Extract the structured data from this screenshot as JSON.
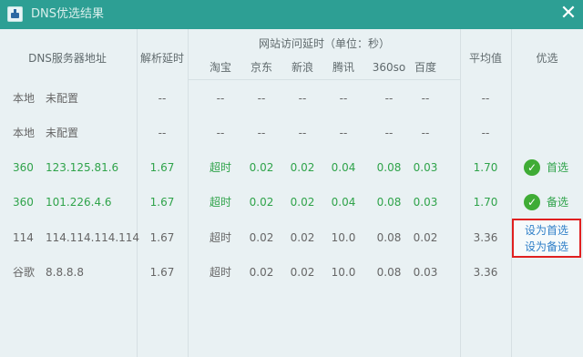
{
  "window": {
    "title": "DNS优选结果",
    "close_glyph": "✕"
  },
  "headers": {
    "server": "DNS服务器地址",
    "resolve_delay": "解析延时",
    "site_group": "网站访问延时（单位：秒）",
    "sites": [
      "淘宝",
      "京东",
      "新浪",
      "腾讯",
      "360so",
      "百度"
    ],
    "average": "平均值",
    "preferred": "优选"
  },
  "rows": [
    {
      "isp": "本地",
      "address": "未配置",
      "resolve": "--",
      "sites": [
        "--",
        "--",
        "--",
        "--",
        "--",
        "--"
      ],
      "average": "--",
      "status": ""
    },
    {
      "isp": "本地",
      "address": "未配置",
      "resolve": "--",
      "sites": [
        "--",
        "--",
        "--",
        "--",
        "--",
        "--"
      ],
      "average": "--",
      "status": ""
    },
    {
      "isp": "360",
      "address": "123.125.81.6",
      "resolve": "1.67",
      "sites": [
        "超时",
        "0.02",
        "0.02",
        "0.04",
        "0.08",
        "0.03"
      ],
      "average": "1.70",
      "status": "首选"
    },
    {
      "isp": "360",
      "address": "101.226.4.6",
      "resolve": "1.67",
      "sites": [
        "超时",
        "0.02",
        "0.02",
        "0.04",
        "0.08",
        "0.03"
      ],
      "average": "1.70",
      "status": "备选"
    },
    {
      "isp": "114",
      "address": "114.114.114.114",
      "resolve": "1.67",
      "sites": [
        "超时",
        "0.02",
        "0.02",
        "10.0",
        "0.08",
        "0.02"
      ],
      "average": "3.36",
      "status": ""
    },
    {
      "isp": "谷歌",
      "address": "8.8.8.8",
      "resolve": "1.67",
      "sites": [
        "超时",
        "0.02",
        "0.02",
        "10.0",
        "0.08",
        "0.03"
      ],
      "average": "3.36",
      "status": ""
    }
  ],
  "actions": {
    "set_primary": "设为首选",
    "set_secondary": "设为备选"
  },
  "colors": {
    "titlebar": "#2d9f94",
    "green_text": "#2fa34a",
    "link": "#2f7fc8",
    "highlight_box": "#e02020"
  }
}
